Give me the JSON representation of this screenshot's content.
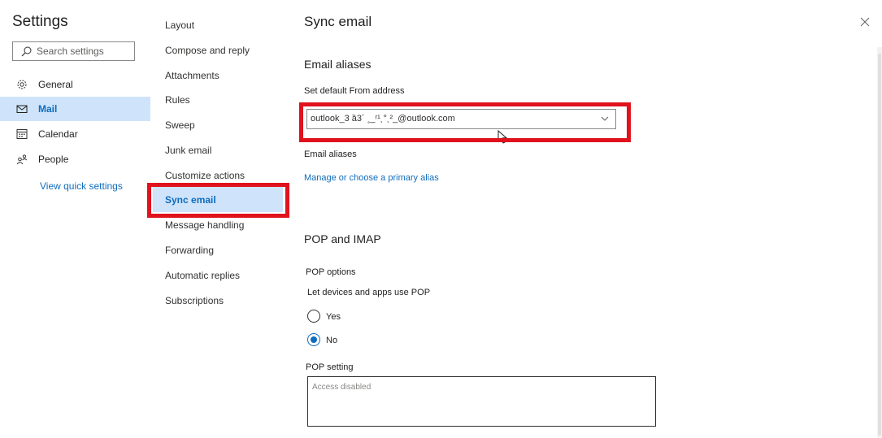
{
  "settings": {
    "title": "Settings",
    "search_placeholder": "Search settings"
  },
  "nav": {
    "items": [
      {
        "label": "General",
        "icon": "gear-icon"
      },
      {
        "label": "Mail",
        "icon": "mail-icon",
        "active": true
      },
      {
        "label": "Calendar",
        "icon": "calendar-icon"
      },
      {
        "label": "People",
        "icon": "people-icon"
      }
    ],
    "quick_settings": "View quick settings"
  },
  "submenu": {
    "items": [
      "Layout",
      "Compose and reply",
      "Attachments",
      "Rules",
      "Sweep",
      "Junk email",
      "Customize actions",
      "Sync email",
      "Message handling",
      "Forwarding",
      "Automatic replies",
      "Subscriptions"
    ],
    "active": "Sync email"
  },
  "main": {
    "title": "Sync email",
    "aliases_heading": "Email aliases",
    "default_from_label": "Set default From address",
    "default_from_value": "outlook_3 ȁ3´ ˳_ʳ¹ˎ°ˎ²_@outlook.com",
    "aliases_label": "Email aliases",
    "manage_alias_link": "Manage or choose a primary alias",
    "pop_imap_heading": "POP and IMAP",
    "pop_options_label": "POP options",
    "let_devices_label": "Let devices and apps use POP",
    "radio_yes": "Yes",
    "radio_no": "No",
    "pop_selected": "No",
    "pop_setting_label": "POP setting",
    "pop_setting_value": "Access disabled"
  },
  "colors": {
    "accent": "#0f6cbd",
    "highlight_bg": "#cfe4fa",
    "annotation_red": "#e0121d"
  }
}
